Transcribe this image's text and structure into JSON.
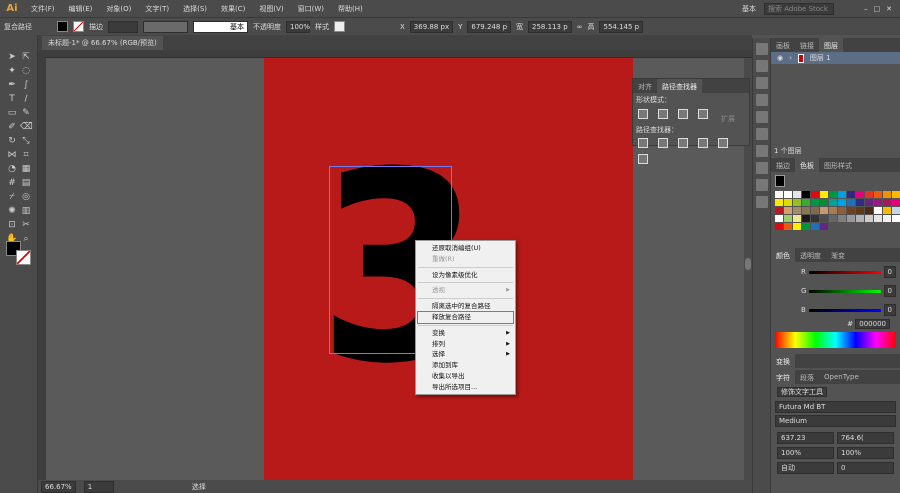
{
  "app": {
    "logo": "Ai",
    "menu": [
      "文件(F)",
      "编辑(E)",
      "对象(O)",
      "文字(T)",
      "选择(S)",
      "效果(C)",
      "视图(V)",
      "窗口(W)",
      "帮助(H)"
    ],
    "workspace": "基本",
    "search_placeholder": "搜索 Adobe Stock"
  },
  "control": {
    "selection_type": "复合路径",
    "stroke_label": "描边",
    "stroke_style": "基本",
    "opacity_label": "不透明度",
    "opacity": "100%",
    "style_label": "样式",
    "x_label": "X",
    "x": "369.88 px",
    "y_label": "Y",
    "y": "679.248 p",
    "w_label": "宽",
    "w": "258.113 p",
    "h_label": "高",
    "h": "554.145 p"
  },
  "document": {
    "tab": "未标题-1* @ 66.67% (RGB/预览)",
    "glyph": "3"
  },
  "context_menu": [
    {
      "label": "还原取消编组(U)",
      "state": "normal"
    },
    {
      "label": "重做(R)",
      "state": "disabled"
    },
    {
      "sep": true
    },
    {
      "label": "设为像素级优化",
      "state": "normal"
    },
    {
      "sep": true
    },
    {
      "label": "透视",
      "state": "disabled",
      "submenu": true
    },
    {
      "sep": true
    },
    {
      "label": "隔离选中的复合路径",
      "state": "normal"
    },
    {
      "label": "释放复合路径",
      "state": "highlight"
    },
    {
      "sep": true
    },
    {
      "label": "变换",
      "state": "normal",
      "submenu": true
    },
    {
      "label": "排列",
      "state": "normal",
      "submenu": true
    },
    {
      "label": "选择",
      "state": "normal",
      "submenu": true
    },
    {
      "label": "添加到库",
      "state": "normal"
    },
    {
      "label": "收集以导出",
      "state": "normal"
    },
    {
      "label": "导出所选项目...",
      "state": "normal"
    }
  ],
  "pathfinder": {
    "tabs": [
      "对齐",
      "路径查找器"
    ],
    "shape_modes": "形状模式：",
    "expand": "扩展",
    "pathfinders": "路径查找器："
  },
  "layers": {
    "tabs": [
      "画板",
      "链接",
      "图层"
    ],
    "layer_name": "图层 1",
    "count": "1 个图层"
  },
  "swatches_panel": {
    "tabs": [
      "描边",
      "色板",
      "图形样式"
    ],
    "colors": [
      "#ffffff",
      "#ffffff",
      "#e6e6e6",
      "#000000",
      "#e30613",
      "#ffed00",
      "#009640",
      "#009fe3",
      "#312783",
      "#e6007e",
      "#e5332a",
      "#ea5b0c",
      "#f39200",
      "#fbba00",
      "#ffe600",
      "#dedc00",
      "#95c11f",
      "#3aaa35",
      "#009640",
      "#008d36",
      "#00a19a",
      "#00a0e9",
      "#1d71b8",
      "#2d2e83",
      "#662483",
      "#951b81",
      "#a3195b",
      "#e6007e",
      "#be1622",
      "#c9a26d",
      "#a38b6d",
      "#8b7355",
      "#7d6a55",
      "#c59a6d",
      "#a67c52",
      "#8b5e3c",
      "#6b4226",
      "#5b3a1e",
      "#4a2d16",
      "#ffffff",
      "#fbba00",
      "#bfd9e8",
      "#ffffff",
      "#9bcb6c",
      "#f0e68c",
      "#1a1a1a",
      "#333333",
      "#4d4d4d",
      "#666666",
      "#808080",
      "#999999",
      "#b3b3b3",
      "#cccccc",
      "#e6e6e6",
      "#f2f2f2",
      "#ffffff",
      "#e30613",
      "#ea5b0c",
      "#ffed00",
      "#009640",
      "#1d71b8",
      "#662483"
    ]
  },
  "color_panel": {
    "tabs": [
      "颜色",
      "透明度",
      "渐变"
    ],
    "r_label": "R",
    "g_label": "G",
    "b_label": "B",
    "r": "0",
    "g": "0",
    "b": "0",
    "hex_label": "#",
    "hex": "000000"
  },
  "transform_panel": {
    "tab": "变换"
  },
  "character_panel": {
    "tabs": [
      "字符",
      "段落",
      "OpenType"
    ],
    "touch_tool": "修饰文字工具",
    "font": "Futura Md BT",
    "style": "Medium",
    "size": "637.23",
    "leading": "764.6(",
    "vscale": "100%",
    "hscale": "100%",
    "kerning": "自动",
    "tracking": "0"
  },
  "status": {
    "zoom": "66.67%",
    "artboard": "1",
    "tool": "选择"
  }
}
